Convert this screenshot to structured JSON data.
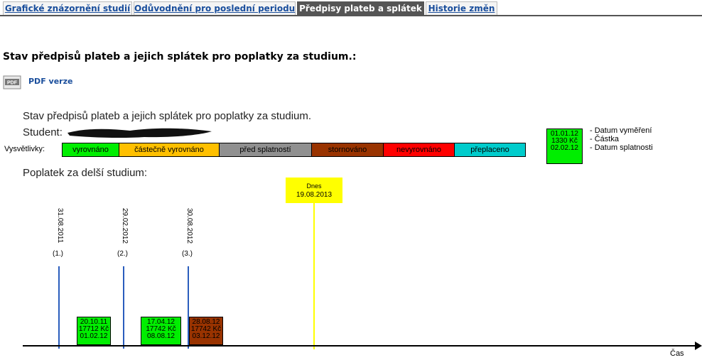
{
  "tabs": [
    {
      "label": "Grafické znázornění studií",
      "active": false
    },
    {
      "label": "Odůvodnění pro poslední periodu",
      "active": false
    },
    {
      "label": "Předpisy plateb a splátek",
      "active": true
    },
    {
      "label": "Historie změn",
      "active": false
    }
  ],
  "heading": "Stav předpisů plateb a jejich splátek pro poplatky za studium.:",
  "pdf_link": "PDF verze",
  "pdf_icon_text": "PDF",
  "chart": {
    "title": "Stav předpisů plateb a jejich splátek pro poplatky za studium.",
    "student_label": "Student:",
    "legend_label": "Vysvětlivky:",
    "legend": [
      {
        "label": "vyrovnáno",
        "color": "#00ee00",
        "text_color": "#000000"
      },
      {
        "label": "částečně vyrovnáno",
        "color": "#ffc000",
        "text_color": "#000000"
      },
      {
        "label": "před splatností",
        "color": "#909090",
        "text_color": "#000000"
      },
      {
        "label": "stornováno",
        "color": "#993300",
        "text_color": "#000000"
      },
      {
        "label": "nevyrovnáno",
        "color": "#ff0000",
        "text_color": "#000000"
      },
      {
        "label": "přeplaceno",
        "color": "#00cccc",
        "text_color": "#000000"
      }
    ],
    "key": {
      "lines": [
        "01.01.12",
        "1330 Kč",
        "02.02.12"
      ],
      "descriptions": [
        "- Datum vyměření",
        "- Částka",
        "- Datum splatnosti"
      ]
    },
    "section_title": "Poplatek za delší studium:",
    "today": {
      "label": "Dnes",
      "date": "19.08.2013"
    },
    "periods": [
      {
        "date": "31.08.2011",
        "num": "(1.)"
      },
      {
        "date": "29.02.2012",
        "num": "(2.)"
      },
      {
        "date": "30.08.2012",
        "num": "(3.)"
      }
    ],
    "payments": [
      {
        "lines": [
          "20.10.11",
          "17712 Kč",
          "01.02.12"
        ],
        "status": "vyrovnáno",
        "color": "#00ee00"
      },
      {
        "lines": [
          "17.04.12",
          "17742 Kč",
          "08.08.12"
        ],
        "status": "vyrovnáno",
        "color": "#00ee00"
      },
      {
        "lines": [
          "28.08.12",
          "17742 Kč",
          "03.12.12"
        ],
        "status": "stornováno",
        "color": "#993300"
      }
    ],
    "axis_label": "Čas"
  }
}
